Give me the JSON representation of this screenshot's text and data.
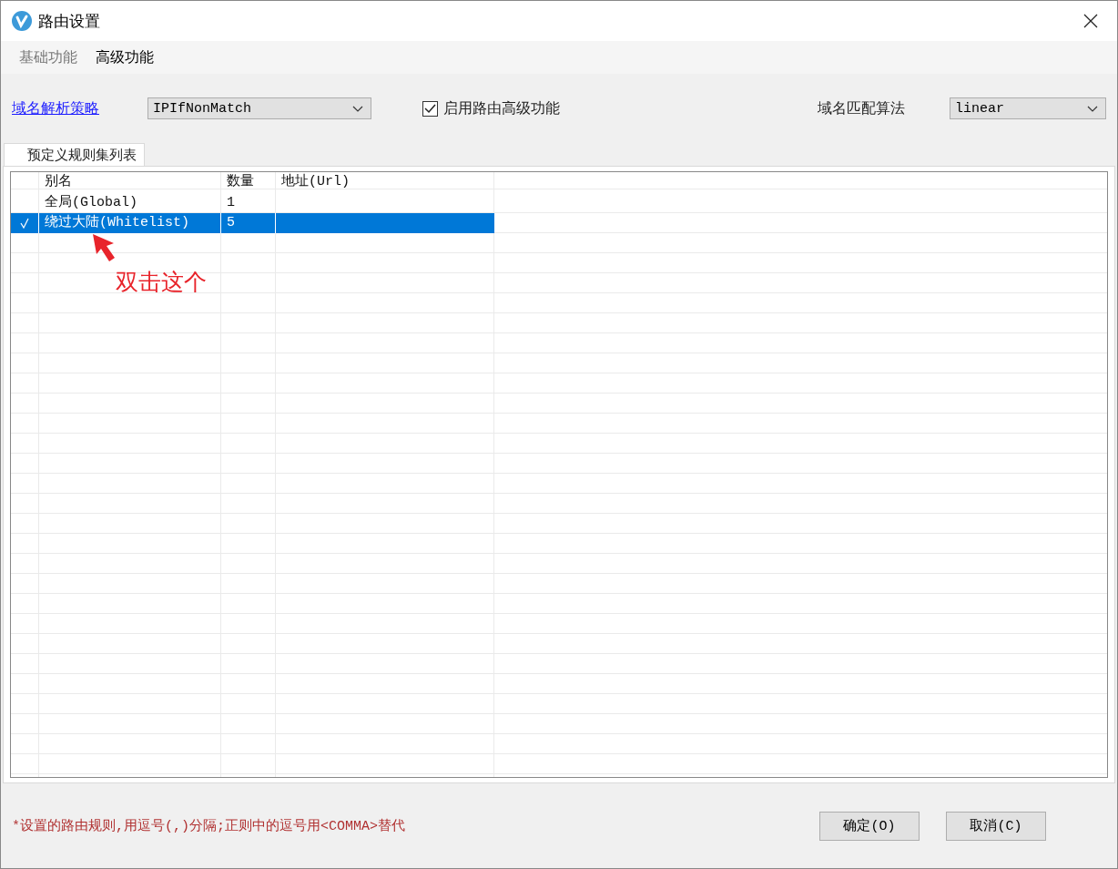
{
  "window": {
    "title": "路由设置"
  },
  "tabs": [
    {
      "label": "基础功能",
      "selected": false
    },
    {
      "label": "高级功能",
      "selected": true
    }
  ],
  "domain_strategy": {
    "label": "域名解析策略",
    "value": "IPIfNonMatch"
  },
  "advanced_enabled": {
    "label": "启用路由高级功能",
    "checked": true
  },
  "match_algorithm": {
    "label": "域名匹配算法",
    "value": "linear"
  },
  "panel_tabs": [
    {
      "label": "预定义规则集列表",
      "selected": true
    }
  ],
  "table": {
    "columns": [
      "别名",
      "数量",
      "地址(Url)"
    ],
    "rows": [
      {
        "checked": false,
        "selected": false,
        "cells": [
          "全局(Global)",
          "1",
          ""
        ]
      },
      {
        "checked": true,
        "selected": true,
        "cells": [
          "绕过大陆(Whitelist)",
          "5",
          ""
        ]
      }
    ]
  },
  "annotation": {
    "text": "双击这个"
  },
  "note": "*设置的路由规则,用逗号(,)分隔;正则中的逗号用<COMMA>替代",
  "buttons": [
    "确定(O)",
    "取消(C)"
  ]
}
